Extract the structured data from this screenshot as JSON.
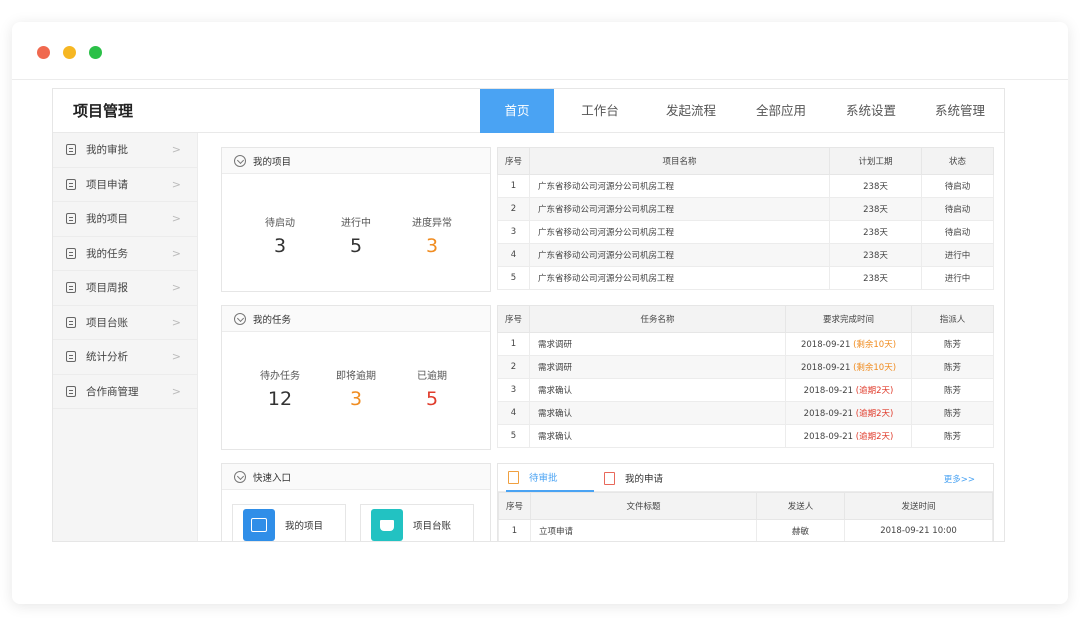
{
  "app_title": "项目管理",
  "nav_tabs": [
    {
      "label": "首页",
      "active": true
    },
    {
      "label": "工作台"
    },
    {
      "label": "发起流程"
    },
    {
      "label": "全部应用"
    },
    {
      "label": "系统设置"
    },
    {
      "label": "系统管理"
    }
  ],
  "sidebar": {
    "items": [
      {
        "label": "我的审批",
        "icon": "list-icon"
      },
      {
        "label": "项目申请",
        "icon": "list-icon"
      },
      {
        "label": "我的项目",
        "icon": "list-icon"
      },
      {
        "label": "我的任务",
        "icon": "list-icon"
      },
      {
        "label": "项目周报",
        "icon": "list-icon"
      },
      {
        "label": "项目台账",
        "icon": "list-icon"
      },
      {
        "label": "统计分析",
        "icon": "list-icon"
      },
      {
        "label": "合作商管理",
        "icon": "list-icon"
      }
    ],
    "chevron": ">"
  },
  "my_projects": {
    "title": "我的项目",
    "stats": [
      {
        "label": "待启动",
        "value": "3"
      },
      {
        "label": "进行中",
        "value": "5"
      },
      {
        "label": "进度异常",
        "value": "3"
      }
    ]
  },
  "my_tasks": {
    "title": "我的任务",
    "stats": [
      {
        "label": "待办任务",
        "value": "12"
      },
      {
        "label": "即将逾期",
        "value": "3"
      },
      {
        "label": "已逾期",
        "value": "5"
      }
    ]
  },
  "quick_entry": {
    "title": "快速入口",
    "items": [
      {
        "label": "我的项目",
        "icon": "calendar-icon"
      },
      {
        "label": "项目台账",
        "icon": "cup-icon"
      }
    ]
  },
  "project_table": {
    "headers": [
      "序号",
      "项目名称",
      "计划工期",
      "状态"
    ],
    "rows": [
      {
        "no": "1",
        "name": "广东省移动公司河源分公司机房工程",
        "duration": "238天",
        "status": "待启动"
      },
      {
        "no": "2",
        "name": "广东省移动公司河源分公司机房工程",
        "duration": "238天",
        "status": "待启动"
      },
      {
        "no": "3",
        "name": "广东省移动公司河源分公司机房工程",
        "duration": "238天",
        "status": "待启动"
      },
      {
        "no": "4",
        "name": "广东省移动公司河源分公司机房工程",
        "duration": "238天",
        "status": "进行中"
      },
      {
        "no": "5",
        "name": "广东省移动公司河源分公司机房工程",
        "duration": "238天",
        "status": "进行中"
      }
    ]
  },
  "task_table": {
    "headers": [
      "序号",
      "任务名称",
      "要求完成时间",
      "指派人"
    ],
    "rows": [
      {
        "no": "1",
        "name": "需求调研",
        "date": "2018-09-21",
        "note": "(剩余10天)",
        "assignee": "陈芳"
      },
      {
        "no": "2",
        "name": "需求调研",
        "date": "2018-09-21",
        "note": "(剩余10天)",
        "assignee": "陈芳"
      },
      {
        "no": "3",
        "name": "需求确认",
        "date": "2018-09-21",
        "note": "(逾期2天)",
        "assignee": "陈芳"
      },
      {
        "no": "4",
        "name": "需求确认",
        "date": "2018-09-21",
        "note": "(逾期2天)",
        "assignee": "陈芳"
      },
      {
        "no": "5",
        "name": "需求确认",
        "date": "2018-09-21",
        "note": "(逾期2天)",
        "assignee": "陈芳"
      }
    ]
  },
  "approval": {
    "tabs": [
      {
        "label": "待审批",
        "active": true,
        "icon": "pending-doc-icon"
      },
      {
        "label": "我的申请",
        "icon": "application-doc-icon"
      }
    ],
    "more": "更多>>",
    "headers": [
      "序号",
      "文件标题",
      "发送人",
      "发送时间"
    ],
    "rows": [
      {
        "no": "1",
        "title": "立项申请",
        "sender": "赫敏",
        "time": "2018-09-21 10:00"
      }
    ]
  },
  "colors": {
    "accent": "#4aa3f3",
    "warning": "#f08c20",
    "danger": "#e03c2c"
  }
}
